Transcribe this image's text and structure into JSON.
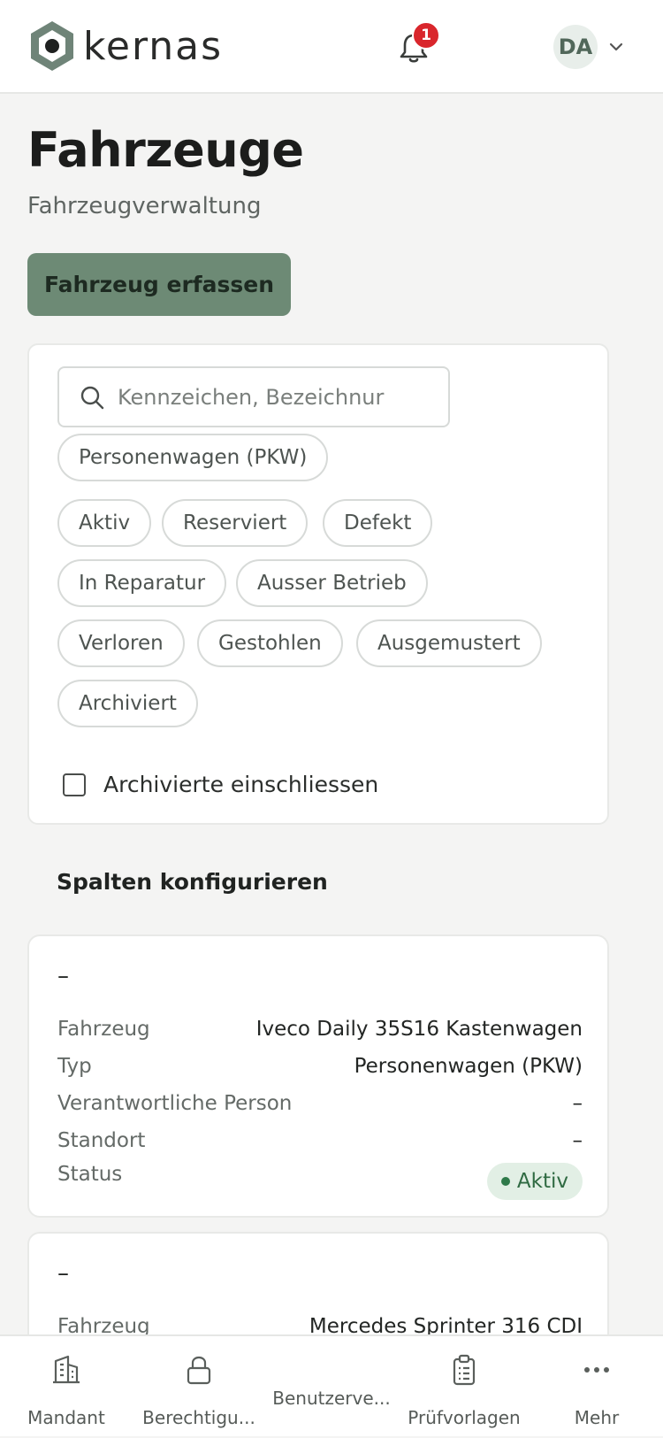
{
  "header": {
    "logo_text": "kernas",
    "notification_count": "1",
    "user_initials": "DA"
  },
  "page": {
    "title": "Fahrzeuge",
    "subtitle": "Fahrzeugverwaltung",
    "add_button_label": "Fahrzeug erfassen"
  },
  "filters": {
    "search_placeholder": "Kennzeichen, Bezeichnur",
    "type_chip": "Personenwagen (PKW)",
    "status_chips": [
      "Aktiv",
      "Reserviert",
      "Defekt",
      "In Reparatur",
      "Ausser Betrieb",
      "Verloren",
      "Gestohlen",
      "Ausgemustert",
      "Archiviert"
    ],
    "include_archived_label": "Archivierte einschliessen"
  },
  "columns_config_label": "Spalten konfigurieren",
  "vehicles": [
    {
      "title": "–",
      "rows": [
        {
          "label": "Fahrzeug",
          "value": "Iveco Daily 35S16 Kastenwagen"
        },
        {
          "label": "Typ",
          "value": "Personenwagen (PKW)"
        },
        {
          "label": "Verantwortliche Person",
          "value": "–"
        },
        {
          "label": "Standort",
          "value": "–"
        },
        {
          "label": "Status",
          "value": "Aktiv"
        }
      ]
    },
    {
      "title": "–",
      "rows": [
        {
          "label": "Fahrzeug",
          "value": "Mercedes Sprinter 316 CDI"
        }
      ]
    }
  ],
  "bottom_nav": [
    {
      "label": "Mandant",
      "icon": "building-icon"
    },
    {
      "label": "Berechtigu...",
      "icon": "lock-icon"
    },
    {
      "label": "Benutzerve...",
      "icon": "users-icon"
    },
    {
      "label": "Prüfvorlagen",
      "icon": "clipboard-icon"
    },
    {
      "label": "Mehr",
      "icon": "more-icon"
    }
  ],
  "colors": {
    "accent": "#6d8a75",
    "badge_red": "#d9262c",
    "status_active_bg": "#e2efe5",
    "status_active_text": "#2f6a42"
  }
}
